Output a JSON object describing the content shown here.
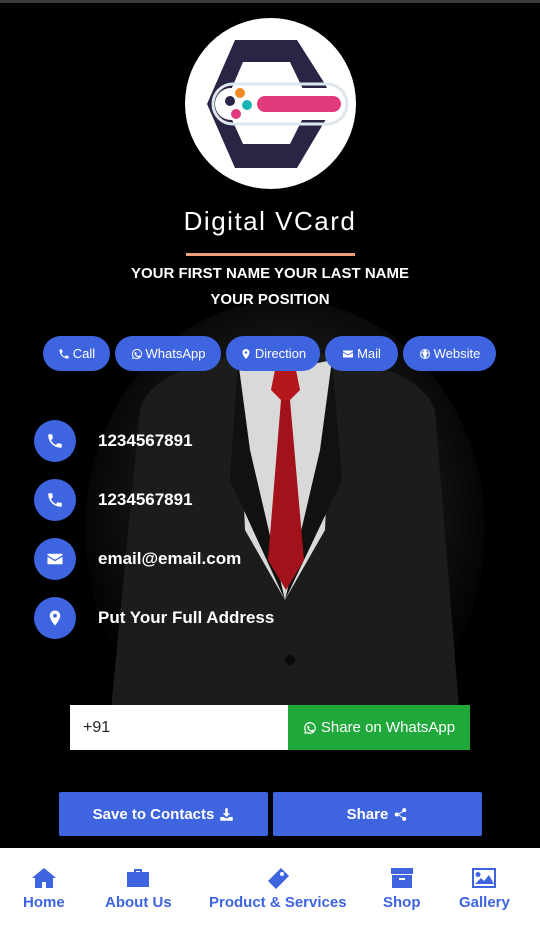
{
  "brand": {
    "title": "Digital VCard"
  },
  "profile": {
    "name": "YOUR FIRST NAME YOUR LAST NAME",
    "position": "YOUR POSITION"
  },
  "actions": [
    {
      "label": "Call",
      "icon": "phone-icon"
    },
    {
      "label": "WhatsApp",
      "icon": "whatsapp-icon"
    },
    {
      "label": "Direction",
      "icon": "map-marker-icon"
    },
    {
      "label": "Mail",
      "icon": "envelope-icon"
    },
    {
      "label": "Website",
      "icon": "globe-icon"
    }
  ],
  "contacts": [
    {
      "icon": "phone-icon",
      "text": "1234567891"
    },
    {
      "icon": "phone-icon",
      "text": "1234567891"
    },
    {
      "icon": "envelope-icon",
      "text": "email@email.com"
    },
    {
      "icon": "map-marker-icon",
      "text": "Put Your Full Address"
    }
  ],
  "share": {
    "phone_value": "+91",
    "button_label": "Share on WhatsApp"
  },
  "buttons": {
    "save_label": "Save to Contacts",
    "share_label": "Share"
  },
  "nav": [
    {
      "label": "Home",
      "icon": "home-icon"
    },
    {
      "label": "About Us",
      "icon": "briefcase-icon"
    },
    {
      "label": "Product & Services",
      "icon": "tag-icon"
    },
    {
      "label": "Shop",
      "icon": "archive-icon"
    },
    {
      "label": "Gallery",
      "icon": "image-icon"
    }
  ],
  "colors": {
    "accent": "#3e64e0",
    "whatsapp": "#21a83b",
    "underline": "#f0a07a",
    "background": "#000000"
  }
}
